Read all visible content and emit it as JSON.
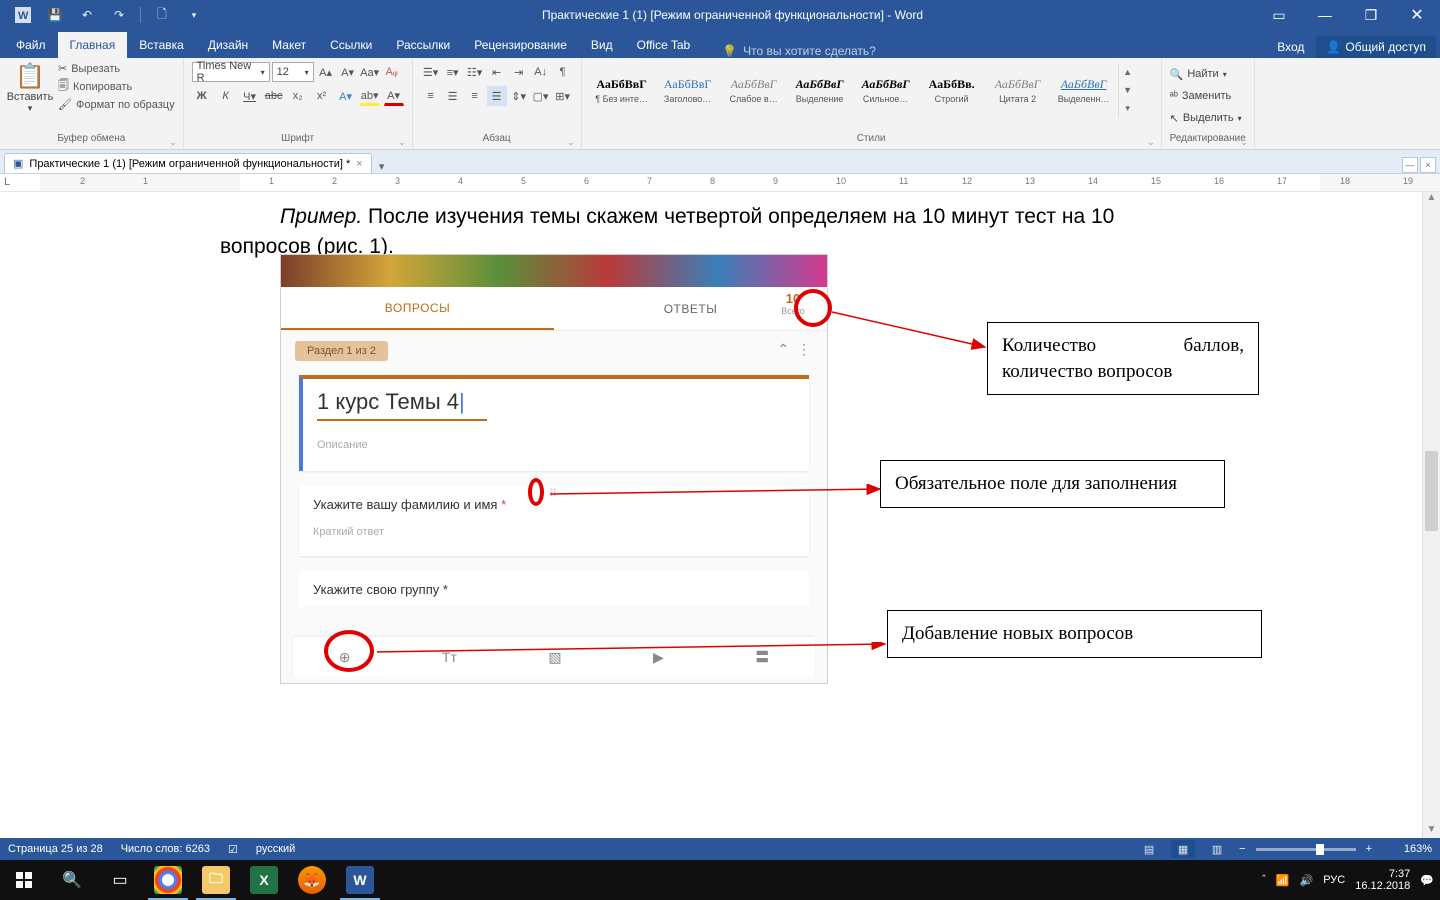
{
  "titlebar": {
    "title": "Практические 1 (1) [Режим ограниченной функциональности] - Word"
  },
  "tabs": {
    "file": "Файл",
    "home": "Главная",
    "insert": "Вставка",
    "design": "Дизайн",
    "layout": "Макет",
    "references": "Ссылки",
    "mailings": "Рассылки",
    "review": "Рецензирование",
    "view": "Вид",
    "officetab": "Office Tab",
    "tellme": "Что вы хотите сделать?",
    "signin": "Вход",
    "share": "Общий доступ"
  },
  "ribbon": {
    "clipboard": {
      "name": "Буфер обмена",
      "paste": "Вставить",
      "cut": "Вырезать",
      "copy": "Копировать",
      "formatpainter": "Формат по образцу"
    },
    "font": {
      "name": "Шрифт",
      "family": "Times New R",
      "size": "12"
    },
    "paragraph": {
      "name": "Абзац"
    },
    "styles": {
      "name": "Стили",
      "items": [
        {
          "preview": "АаБбВвГ",
          "name": "¶ Без инте…"
        },
        {
          "preview": "АаБбВвГ",
          "name": "Заголово…"
        },
        {
          "preview": "АаБбВвГ",
          "name": "Слабое в…"
        },
        {
          "preview": "АаБбВвГ",
          "name": "Выделение"
        },
        {
          "preview": "АаБбВвГ",
          "name": "Сильное…"
        },
        {
          "preview": "АаБбВв.",
          "name": "Строгий"
        },
        {
          "preview": "АаБбВвГ",
          "name": "Цитата 2"
        },
        {
          "preview": "АаБбВвГ",
          "name": "Выделенн…"
        }
      ]
    },
    "editing": {
      "name": "Редактирование",
      "find": "Найти",
      "replace": "Заменить",
      "select": "Выделить"
    }
  },
  "doctab": {
    "name": "Практические 1 (1) [Режим ограниченной функциональности] *"
  },
  "document": {
    "line1prefix": "Пример.",
    "line1rest": " После изучения темы скажем четвертой определяем на 10 минут тест на 10",
    "line2": "вопросов (рис. 1)."
  },
  "form": {
    "tab_q": "ВОПРОСЫ",
    "tab_a": "ОТВЕТЫ",
    "score_num": "10",
    "score_lbl": "Всего",
    "section": "Раздел 1 из 2",
    "title": "1 курс Темы 4",
    "desc": "Описание",
    "q1": "Укажите вашу фамилию и имя",
    "short": "Краткий ответ",
    "q2": "Укажите свою группу",
    "asterisk": "*"
  },
  "callouts": {
    "c1": "Количество баллов, количество вопросов",
    "c2": "Обязательное поле для заполнения",
    "c3": "Добавление новых вопросов"
  },
  "statusbar": {
    "page": "Страница 25 из 28",
    "words": "Число слов: 6263",
    "lang": "русский",
    "zoom": "163%"
  },
  "tray": {
    "up": "ˆ",
    "lang": "РУС",
    "time": "7:37",
    "date": "16.12.2018"
  },
  "ruler_ticks": [
    "2",
    "1",
    "",
    "1",
    "2",
    "3",
    "4",
    "5",
    "6",
    "7",
    "8",
    "9",
    "10",
    "11",
    "12",
    "13",
    "14",
    "15",
    "16",
    "17",
    "18",
    "19"
  ]
}
